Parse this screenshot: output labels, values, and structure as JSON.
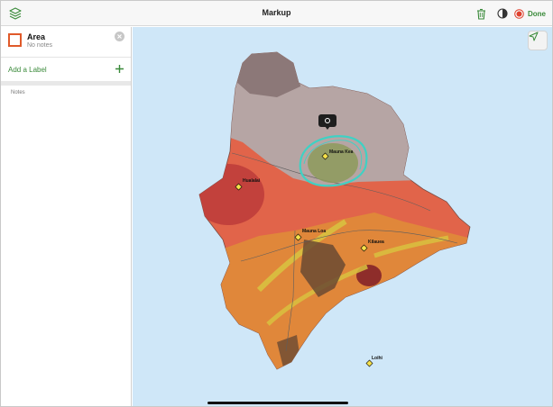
{
  "header": {
    "title": "Markup",
    "done_label": "Done",
    "icons": {
      "layers": "layers-icon",
      "trash": "trash-icon",
      "contrast": "contrast-icon",
      "done": "record-icon"
    }
  },
  "sidebar": {
    "area": {
      "title": "Area",
      "subtitle": "No notes"
    },
    "add_label": "Add a Label",
    "notes_label": "Notes"
  },
  "map": {
    "labels": {
      "mauna_kea": "Mauna Kea",
      "hualalai": "Hualalai",
      "mauna_loa": "Mauna Loa",
      "kilauea": "Kilauea",
      "loihi": "Loihi"
    }
  },
  "colors": {
    "accent_green": "#3a8a3a",
    "area_outline": "#e05a2a",
    "done_red": "#e0412e",
    "ocean": "#cfe7f8",
    "sketch_cyan": "#3fd1c4"
  }
}
